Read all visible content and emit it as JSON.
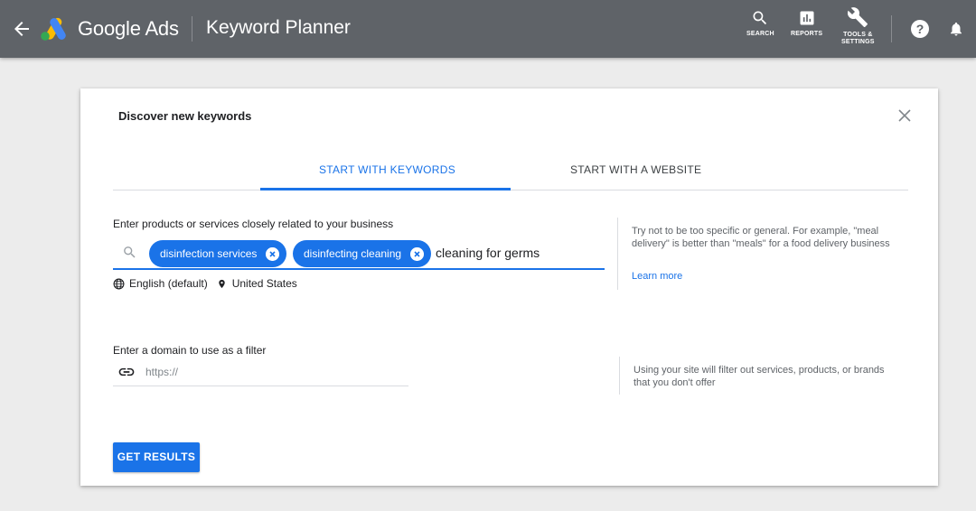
{
  "topbar": {
    "brand": "Google Ads",
    "tool_title": "Keyword Planner",
    "search_label": "SEARCH",
    "reports_label": "REPORTS",
    "tools_label_line1": "TOOLS &",
    "tools_label_line2": "SETTINGS",
    "help_glyph": "?",
    "colors": {
      "bar": "#5f6368",
      "logo_blue": "#4285f4",
      "logo_yellow": "#fbbc04",
      "logo_green": "#34a853"
    }
  },
  "panel": {
    "title": "Discover new keywords",
    "tabs": [
      {
        "label": "START WITH KEYWORDS",
        "active": true
      },
      {
        "label": "START WITH A WEBSITE",
        "active": false
      }
    ],
    "keywords": {
      "label": "Enter products or services closely related to your business",
      "chips": [
        "disinfection services",
        "disinfecting cleaning"
      ],
      "typed_value": "cleaning for germs",
      "language": "English (default)",
      "location": "United States",
      "hint": "Try not to be too specific or general. For example, \"meal delivery\" is better than \"meals\" for a food delivery business",
      "learn_more": "Learn more"
    },
    "domain": {
      "label": "Enter a domain to use as a filter",
      "placeholder": "https://",
      "hint": "Using your site will filter out services, products, or brands that you don't offer"
    },
    "submit_label": "GET RESULTS",
    "accent": "#1a73e8"
  }
}
